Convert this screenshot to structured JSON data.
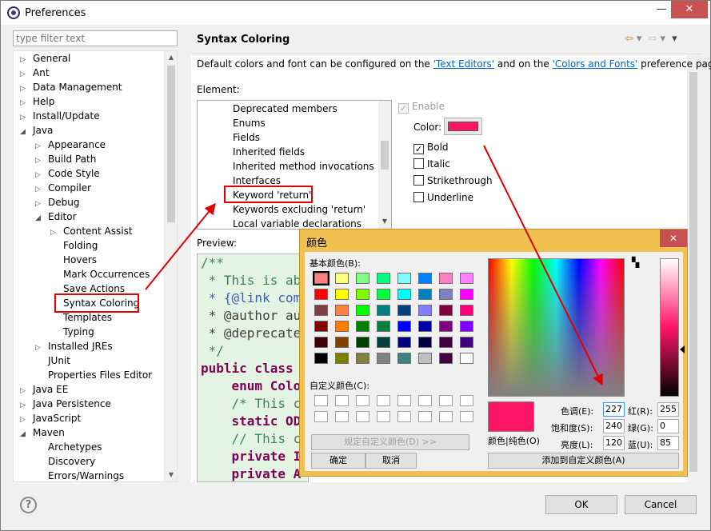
{
  "window": {
    "title": "Preferences"
  },
  "filter": {
    "placeholder": "type filter text"
  },
  "tree": [
    {
      "label": "General",
      "level": 0,
      "twisty": "▷"
    },
    {
      "label": "Ant",
      "level": 0,
      "twisty": "▷"
    },
    {
      "label": "Data Management",
      "level": 0,
      "twisty": "▷"
    },
    {
      "label": "Help",
      "level": 0,
      "twisty": "▷"
    },
    {
      "label": "Install/Update",
      "level": 0,
      "twisty": "▷"
    },
    {
      "label": "Java",
      "level": 0,
      "twisty": "◢"
    },
    {
      "label": "Appearance",
      "level": 1,
      "twisty": "▷"
    },
    {
      "label": "Build Path",
      "level": 1,
      "twisty": "▷"
    },
    {
      "label": "Code Style",
      "level": 1,
      "twisty": "▷"
    },
    {
      "label": "Compiler",
      "level": 1,
      "twisty": "▷"
    },
    {
      "label": "Debug",
      "level": 1,
      "twisty": "▷"
    },
    {
      "label": "Editor",
      "level": 1,
      "twisty": "◢"
    },
    {
      "label": "Content Assist",
      "level": 2,
      "twisty": "▷"
    },
    {
      "label": "Folding",
      "level": 2,
      "twisty": ""
    },
    {
      "label": "Hovers",
      "level": 2,
      "twisty": ""
    },
    {
      "label": "Mark Occurrences",
      "level": 2,
      "twisty": ""
    },
    {
      "label": "Save Actions",
      "level": 2,
      "twisty": ""
    },
    {
      "label": "Syntax Coloring",
      "level": 2,
      "twisty": ""
    },
    {
      "label": "Templates",
      "level": 2,
      "twisty": ""
    },
    {
      "label": "Typing",
      "level": 2,
      "twisty": ""
    },
    {
      "label": "Installed JREs",
      "level": 1,
      "twisty": "▷"
    },
    {
      "label": "JUnit",
      "level": 1,
      "twisty": ""
    },
    {
      "label": "Properties Files Editor",
      "level": 1,
      "twisty": ""
    },
    {
      "label": "Java EE",
      "level": 0,
      "twisty": "▷"
    },
    {
      "label": "Java Persistence",
      "level": 0,
      "twisty": "▷"
    },
    {
      "label": "JavaScript",
      "level": 0,
      "twisty": "▷"
    },
    {
      "label": "Maven",
      "level": 0,
      "twisty": "◢"
    },
    {
      "label": "Archetypes",
      "level": 1,
      "twisty": ""
    },
    {
      "label": "Discovery",
      "level": 1,
      "twisty": ""
    },
    {
      "label": "Errors/Warnings",
      "level": 1,
      "twisty": ""
    }
  ],
  "panel": {
    "title": "Syntax Coloring",
    "desc_before": "Default colors and font can be configured on the ",
    "link1": "'Text Editors'",
    "desc_mid": " and on the ",
    "link2": "'Colors and Fonts'",
    "desc_after": " preference page.",
    "element_label": "Element:",
    "elements": [
      "Deprecated members",
      "Enums",
      "Fields",
      "Inherited fields",
      "Inherited method invocations",
      "Interfaces",
      "Keyword 'return'",
      "Keywords excluding 'return'",
      "Local variable declarations"
    ],
    "enable_label": "Enable",
    "color_label": "Color:",
    "bold_label": "Bold",
    "italic_label": "Italic",
    "strike_label": "Strikethrough",
    "underline_label": "Underline",
    "preview_label": "Preview:",
    "selected_color": "#ff1566"
  },
  "preview_lines": [
    {
      "text": "/**",
      "color": "#3f7f5f",
      "bold": false
    },
    {
      "text": " * This is ab",
      "color": "#3f7f5f",
      "bold": false
    },
    {
      "text": " * {@link com",
      "color": "#3f5fbf",
      "bold": false
    },
    {
      "text": " * @author au",
      "color": "#3f3f3f",
      "bold": false
    },
    {
      "text": " * @deprecate",
      "color": "#3f3f3f",
      "bold": false
    },
    {
      "text": " */",
      "color": "#3f7f5f",
      "bold": false
    },
    {
      "text": "public class",
      "color": "#7f0055",
      "bold": true
    },
    {
      "text": "    enum Colo",
      "color": "#7f0055",
      "bold": true
    },
    {
      "text": "    /* This c",
      "color": "#3f7f5f",
      "bold": false
    },
    {
      "text": "    static OD",
      "color": "#7f0055",
      "bold": true
    },
    {
      "text": "    // This c",
      "color": "#3f7f5f",
      "bold": false
    },
    {
      "text": "    private I",
      "color": "#7f0055",
      "bold": true
    },
    {
      "text": "    private A",
      "color": "#7f0055",
      "bold": true
    }
  ],
  "color_dialog": {
    "title": "颜色",
    "basic_label": "基本颜色(B):",
    "custom_label": "自定义颜色(C):",
    "define_btn": "规定自定义颜色(D) >>",
    "ok_btn": "确定",
    "cancel_btn": "取消",
    "solid_label": "颜色|纯色(O)",
    "hue_label": "色调(E):",
    "hue": "227",
    "sat_label": "饱和度(S):",
    "sat": "240",
    "lum_label": "亮度(L):",
    "lum": "120",
    "red_label": "红(R):",
    "red": "255",
    "green_label": "绿(G):",
    "green": "0",
    "blue_label": "蓝(U):",
    "blue": "85",
    "add_btn": "添加到自定义颜色(A)",
    "basic_colors": [
      "#ff8080",
      "#ffff80",
      "#80ff80",
      "#00ff80",
      "#80ffff",
      "#0080ff",
      "#ff80c0",
      "#ff80ff",
      "#ff0000",
      "#ffff00",
      "#80ff00",
      "#00ff40",
      "#00ffff",
      "#0080c0",
      "#8080c0",
      "#ff00ff",
      "#804040",
      "#ff8040",
      "#00ff00",
      "#008080",
      "#004080",
      "#8080ff",
      "#800040",
      "#ff0080",
      "#800000",
      "#ff8000",
      "#008000",
      "#008040",
      "#0000ff",
      "#0000a0",
      "#800080",
      "#8000ff",
      "#400000",
      "#804000",
      "#004000",
      "#004040",
      "#000080",
      "#000040",
      "#400040",
      "#400080",
      "#000000",
      "#808000",
      "#808040",
      "#808080",
      "#408080",
      "#c0c0c0",
      "#400040",
      "#ffffff"
    ]
  },
  "buttons": {
    "ok": "OK",
    "cancel": "Cancel"
  }
}
